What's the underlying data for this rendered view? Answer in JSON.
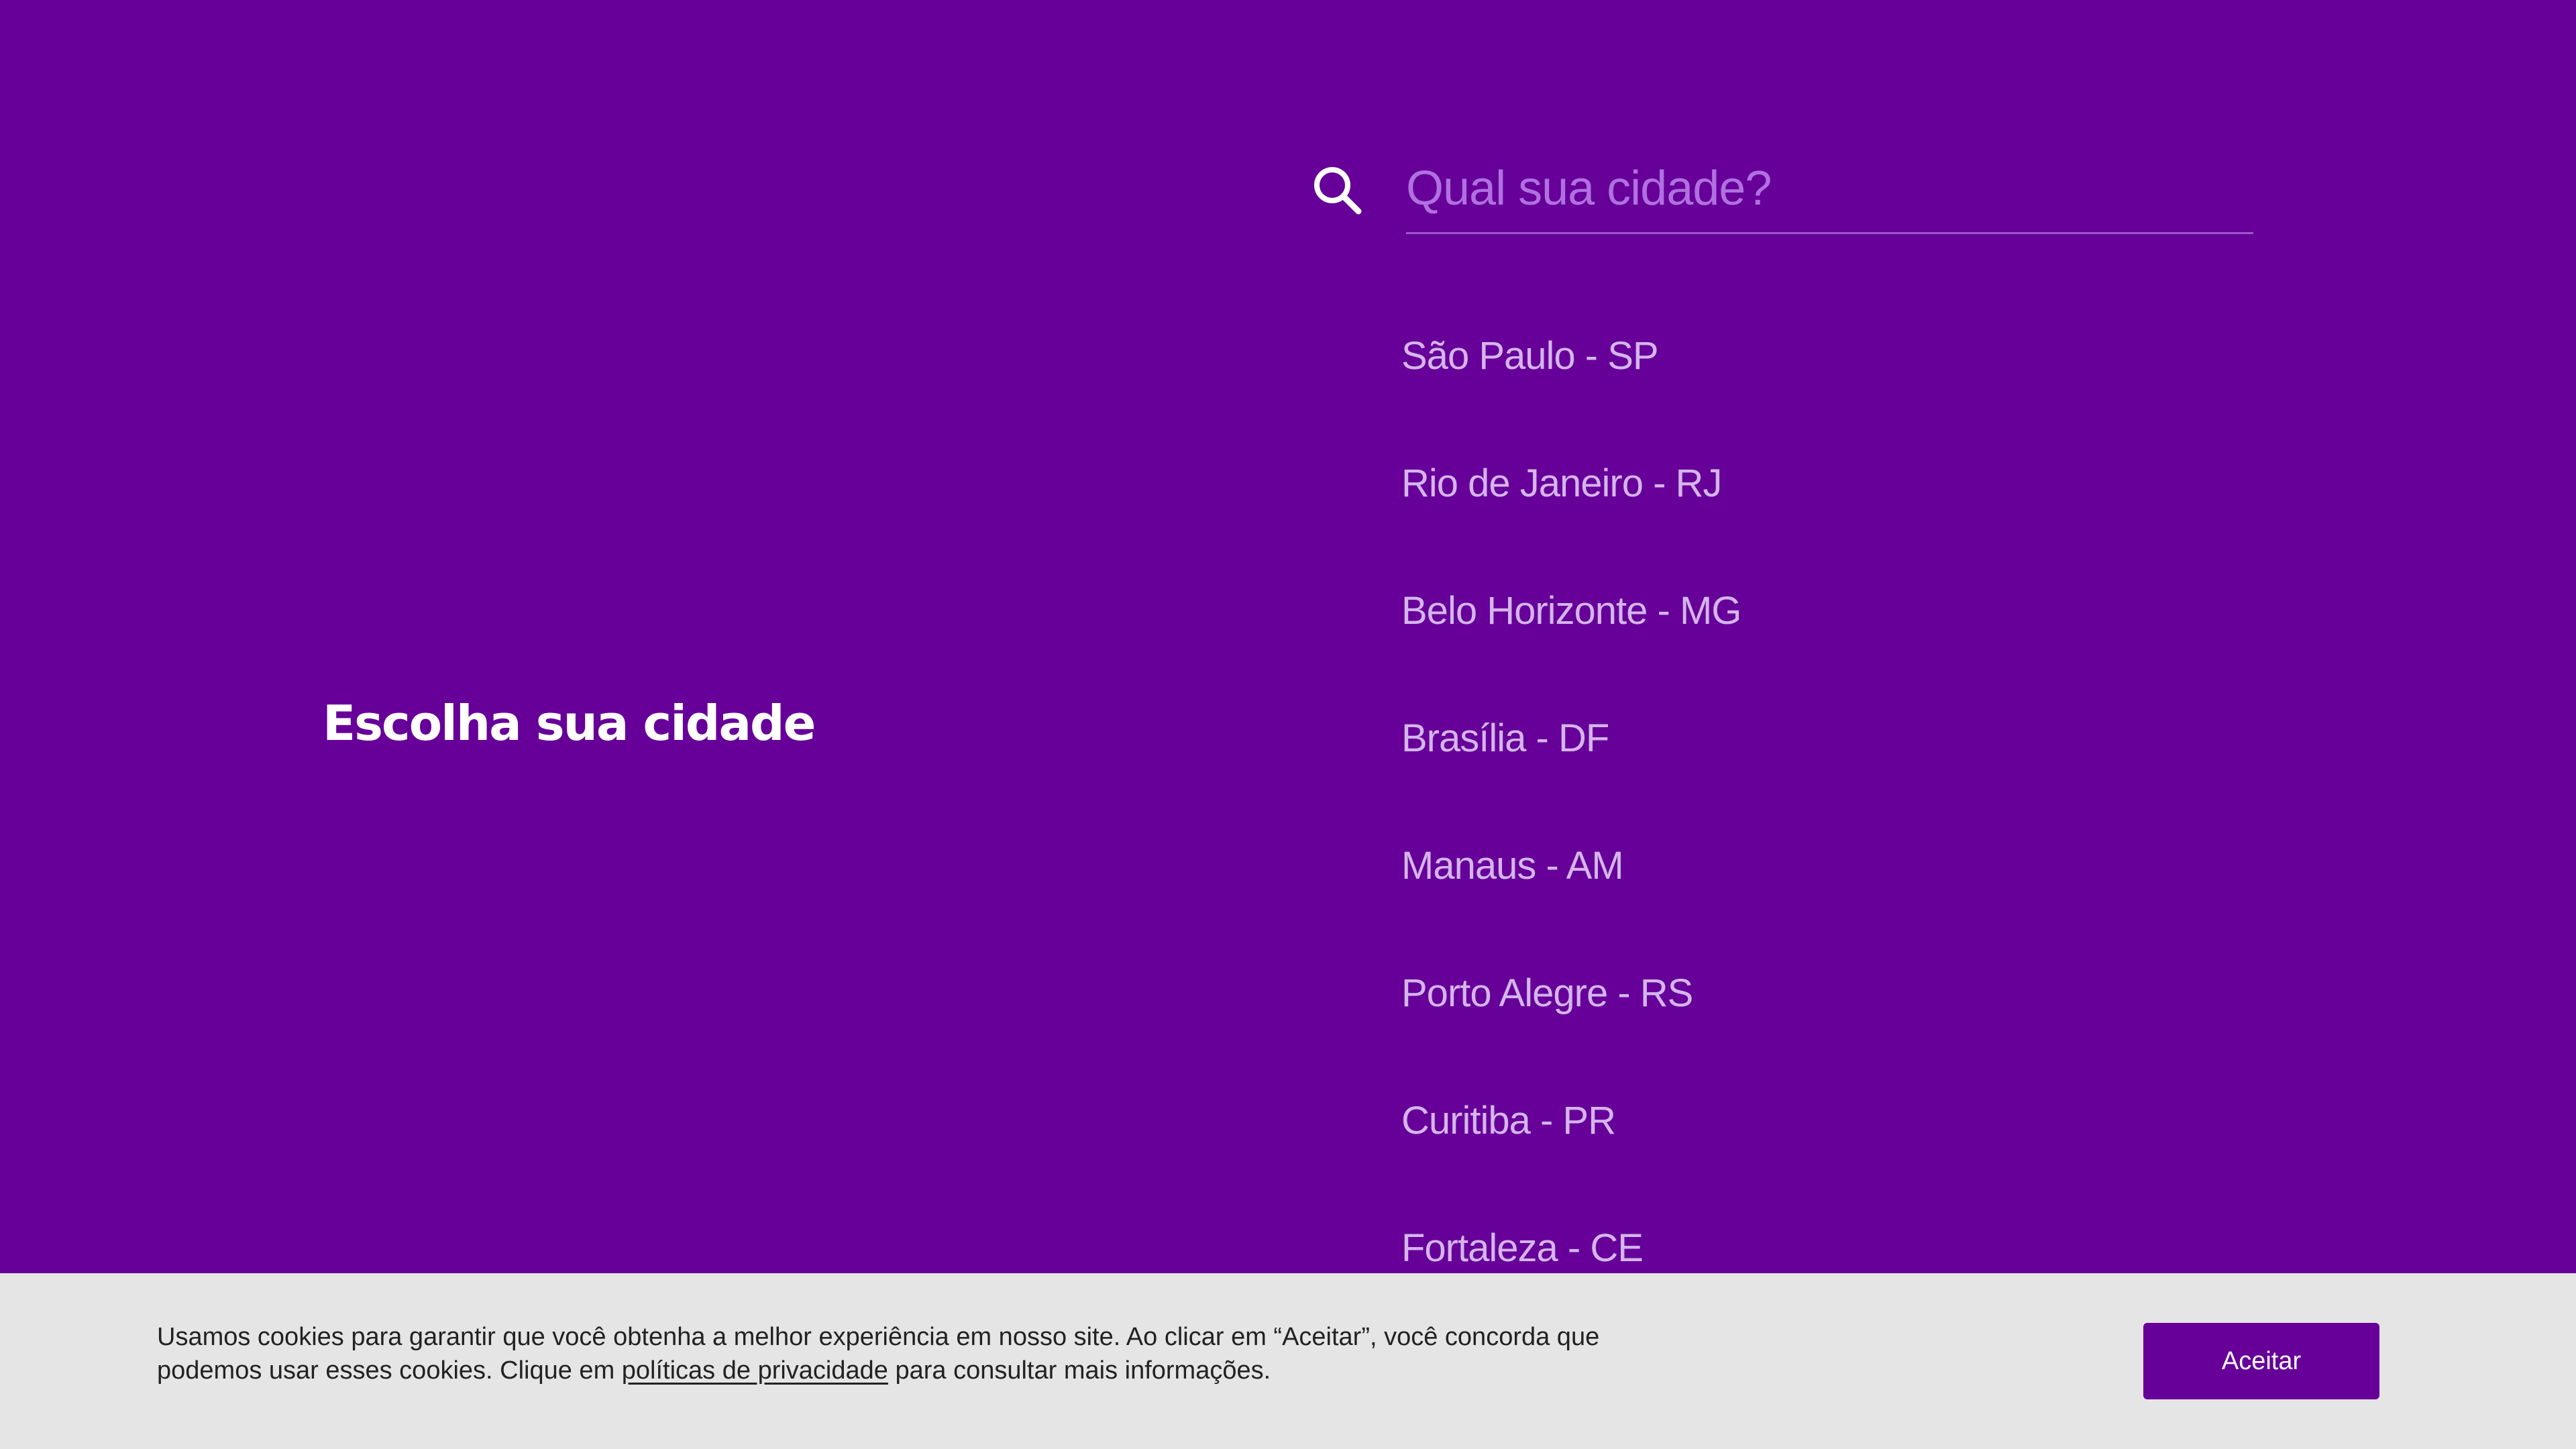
{
  "heading": "Escolha sua cidade",
  "search": {
    "icon": "search-icon",
    "placeholder": "Qual sua cidade?",
    "value": ""
  },
  "cities": [
    "São Paulo - SP",
    "Rio de Janeiro - RJ",
    "Belo Horizonte - MG",
    "Brasília - DF",
    "Manaus - AM",
    "Porto Alegre - RS",
    "Curitiba - PR",
    "Fortaleza - CE"
  ],
  "cookie": {
    "text_before": "Usamos cookies para garantir que você obtenha a melhor experiência em nosso site. Ao clicar em “Aceitar”, você concorda que podemos usar esses cookies. Clique em ",
    "link": "políticas de privacidade",
    "text_after": " para consultar mais informações.",
    "accept_label": "Aceitar"
  },
  "colors": {
    "background": "#660099",
    "city_text": "#d4b5ec",
    "cookie_bar": "#e5e5e5",
    "button": "#660099"
  }
}
